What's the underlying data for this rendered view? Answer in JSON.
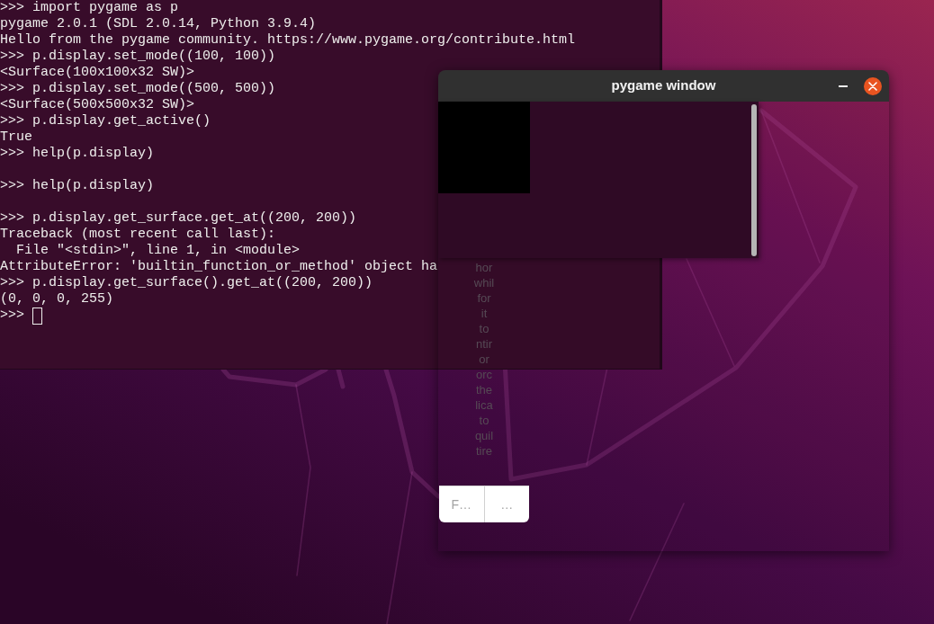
{
  "terminal": {
    "lines": [
      {
        "text": ">>> import pygame as p"
      },
      {
        "text": "pygame 2.0.1 (SDL 2.0.14, Python 3.9.4)"
      },
      {
        "text": "Hello from the pygame community. https://www.pygame.org/contribute.html"
      },
      {
        "text": ">>> p.display.set_mode((100, 100))"
      },
      {
        "text": "<Surface(100x100x32 SW)>"
      },
      {
        "text": ">>> p.display.set_mode((500, 500))"
      },
      {
        "text": "<Surface(500x500x32 SW)>"
      },
      {
        "text": ">>> p.display.get_active()"
      },
      {
        "text": "True"
      },
      {
        "text": ">>> help(p.display)",
        "blank_after": true
      },
      {
        "text": ">>> help(p.display)",
        "blank_after": true
      },
      {
        "text": ">>> p.display.get_surface.get_at((200, 200))"
      },
      {
        "text": "Traceback (most recent call last):"
      },
      {
        "text": "  File \"<stdin>\", line 1, in <module>"
      },
      {
        "text": "AttributeError: 'builtin_function_or_method' object ha"
      },
      {
        "text": ">>> p.display.get_surface().get_at((200, 200))"
      },
      {
        "text": "(0, 0, 0, 255)"
      },
      {
        "text": ">>>",
        "cursor": true
      }
    ]
  },
  "pygame_window": {
    "title": "pygame window",
    "faded_text": [
      "hor",
      "whil",
      "for",
      "it",
      "to",
      "ntir",
      "or",
      "orc",
      "the",
      "lica",
      "to",
      "quil",
      "tire"
    ],
    "dialog": {
      "buttons": [
        "F…",
        "…"
      ]
    }
  }
}
